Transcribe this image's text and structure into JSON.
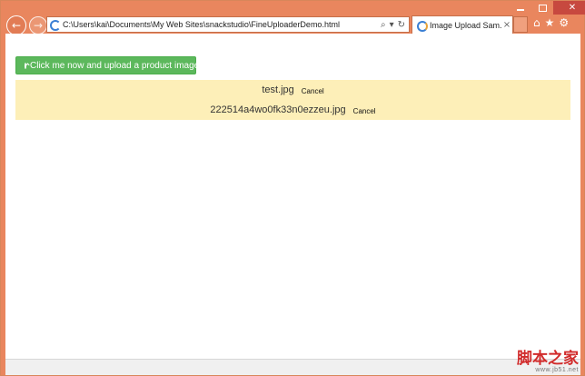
{
  "browser": {
    "address_url": "C:\\Users\\kai\\Documents\\My Web Sites\\snackstudio\\FineUploaderDemo.html",
    "tab_title": "Image Upload Sam...",
    "tab_close": "×",
    "nav_back": "←",
    "nav_forward": "→",
    "address_tools": [
      "⌕",
      "▾",
      "↻"
    ],
    "right_tools": [
      "⌂",
      "★",
      "⚙"
    ]
  },
  "page": {
    "upload_button_label": "Click me now and upload a product image",
    "files": [
      {
        "name": "test.jpg",
        "action": "Cancel"
      },
      {
        "name": "222514a4wo0fk33n0ezzeu.jpg",
        "action": "Cancel"
      }
    ]
  },
  "watermark": {
    "line1": "脚本之家",
    "line2": "www.jb51.net"
  },
  "colors": {
    "frame": "#e9865e",
    "button": "#5cb85c",
    "file_list_bg": "#fdefb8"
  }
}
